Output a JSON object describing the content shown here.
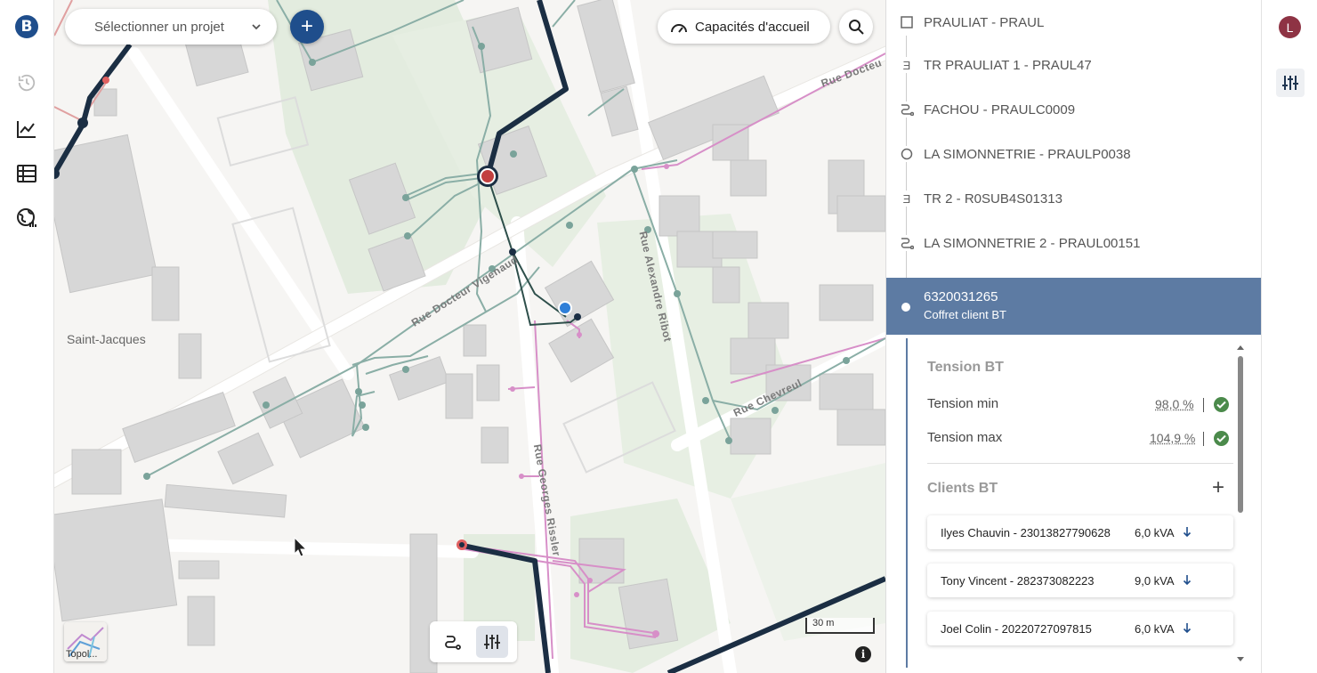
{
  "header": {
    "project_placeholder": "Sélectionner un projet",
    "add_label": "+",
    "capacity_label": "Capacités d'accueil"
  },
  "map": {
    "place_label": "Saint-Jacques",
    "street_labels": [
      "Rue Docteur Vigenaud",
      "Rue Alexandre Ribot",
      "Rue Chevreul",
      "Rue Georges Rissler",
      "Rue Docteu"
    ],
    "scale_label": "30 m",
    "layer_thumb_label": "Topol..."
  },
  "tree": {
    "items": [
      {
        "label": "PRAULIAT - PRAUL",
        "icon": "square-icon"
      },
      {
        "label": "TR PRAULIAT 1 - PRAUL47",
        "icon": "transformer-icon"
      },
      {
        "label": "FACHOU - PRAULC0009",
        "icon": "route-icon"
      },
      {
        "label": "LA SIMONNETRIE - PRAULP0038",
        "icon": "circle-icon"
      },
      {
        "label": "TR 2 - R0SUB4S01313",
        "icon": "transformer-icon"
      },
      {
        "label": "LA SIMONNETRIE 2 - PRAUL00151",
        "icon": "route-icon"
      }
    ],
    "selected": {
      "id": "6320031265",
      "subtitle": "Coffret client BT"
    }
  },
  "detail": {
    "tension_title": "Tension BT",
    "tension_min_label": "Tension min",
    "tension_min_value": "98,0 %",
    "tension_max_label": "Tension max",
    "tension_max_value": "104,9 %",
    "clients_title": "Clients BT",
    "clients": [
      {
        "name": "Ilyes Chauvin - 23013827790628",
        "power": "6,0 kVA"
      },
      {
        "name": "Tony Vincent - 282373082223",
        "power": "9,0 kVA"
      },
      {
        "name": "Joel Colin - 20220727097815",
        "power": "6,0 kVA"
      }
    ]
  },
  "user": {
    "initial": "L"
  },
  "colors": {
    "brand": "#1f4e8c",
    "selected": "#5d7ba3",
    "ok": "#4b8a4b",
    "avatar": "#8e3344"
  }
}
